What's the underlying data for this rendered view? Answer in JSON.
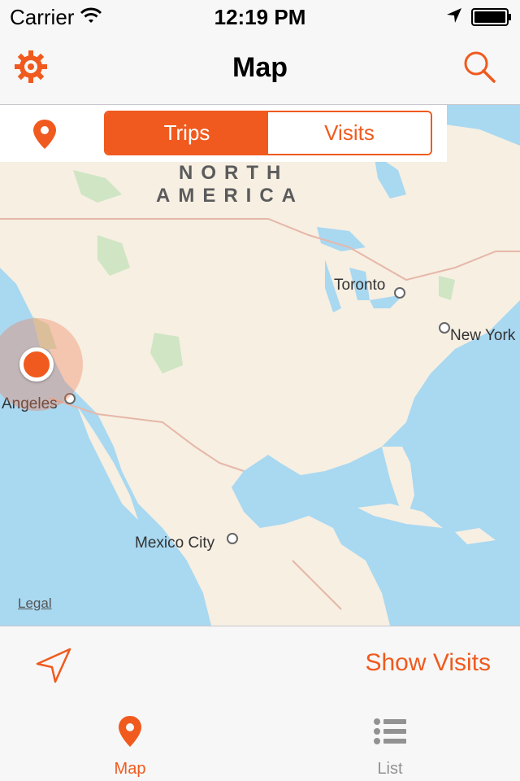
{
  "status_bar": {
    "carrier": "Carrier",
    "time": "12:19 PM"
  },
  "nav": {
    "title": "Map",
    "settings_icon": "gear-icon",
    "search_icon": "search-icon"
  },
  "filter": {
    "pin_icon": "map-pin-icon",
    "segments": [
      "Trips",
      "Visits"
    ],
    "selected": "Trips"
  },
  "map": {
    "region_label_line1": "NORTH",
    "region_label_line2": "AMERICA",
    "cities": {
      "toronto": "Toronto",
      "new_york": "New York",
      "los_angeles": "Angeles",
      "mexico_city": "Mexico City"
    },
    "legal": "Legal"
  },
  "toolbar": {
    "locate_icon": "location-arrow-icon",
    "show_visits": "Show Visits"
  },
  "tabs": [
    {
      "label": "Map",
      "icon": "map-pin-icon",
      "selected": true
    },
    {
      "label": "List",
      "icon": "list-icon",
      "selected": false
    }
  ],
  "colors": {
    "accent": "#f05a1e",
    "water": "#a9d8f1",
    "land": "#f6efe2"
  }
}
